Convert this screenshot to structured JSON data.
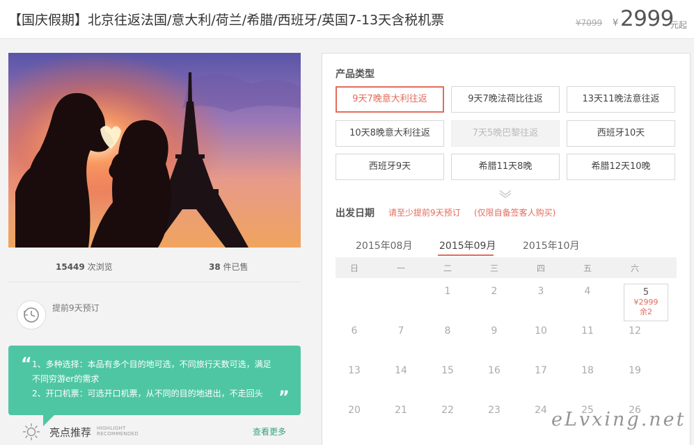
{
  "header": {
    "title": "【国庆假期】北京往返法国/意大利/荷兰/希腊/西班牙/英国7-13天含税机票",
    "original_price": "¥7099",
    "currency": "¥",
    "price": "2999",
    "price_suffix": "元起"
  },
  "stats": {
    "views_count": "15449",
    "views_label": "次浏览",
    "sold_count": "38",
    "sold_label": "件已售"
  },
  "advance": {
    "icon": "clock-icon",
    "text": "提前9天预订"
  },
  "highlights": {
    "open_quote": "“",
    "close_quote": "”",
    "line1": "1、多种选择：本品有多个目的地可选，不同旅行天数可选，满足不同穷游er的需求",
    "line2": "2、开口机票：可选开口机票，从不同的目的地进出，不走回头",
    "title": "亮点推荐",
    "title_en": [
      "HIGHLIGHT",
      "RECOMMENDED"
    ],
    "more_link": "查看更多"
  },
  "product": {
    "label": "产品类型",
    "options": [
      {
        "label": "9天7晚意大利往返",
        "state": "selected"
      },
      {
        "label": "9天7晚法荷比往返",
        "state": "normal"
      },
      {
        "label": "13天11晚法意往返",
        "state": "normal"
      },
      {
        "label": "10天8晚意大利往返",
        "state": "normal"
      },
      {
        "label": "7天5晚巴黎往返",
        "state": "disabled"
      },
      {
        "label": "西班牙10天",
        "state": "normal"
      },
      {
        "label": "西班牙9天",
        "state": "normal"
      },
      {
        "label": "希腊11天8晚",
        "state": "normal"
      },
      {
        "label": "希腊12天10晚",
        "state": "normal"
      }
    ]
  },
  "departure": {
    "label": "出发日期",
    "notice1": "请至少提前9天预订",
    "notice2": "(仅限自备签客人购买)",
    "months": [
      "2015年08月",
      "2015年09月",
      "2015年10月"
    ],
    "active_month": "2015年09月",
    "weekdays": [
      "日",
      "一",
      "二",
      "三",
      "四",
      "五",
      "六"
    ],
    "weeks": [
      [
        "",
        "",
        "1",
        "2",
        "3",
        "4",
        "5"
      ],
      [
        "6",
        "7",
        "8",
        "9",
        "10",
        "11",
        "12"
      ],
      [
        "13",
        "14",
        "15",
        "16",
        "17",
        "18",
        "19"
      ],
      [
        "20",
        "21",
        "22",
        "23",
        "24",
        "25",
        "26"
      ]
    ],
    "available": {
      "day": "5",
      "price": "¥2999",
      "remaining": "余2"
    }
  },
  "watermark": "eLvxing.net",
  "colors": {
    "accent": "#e36b5c",
    "teal": "#4fc6a3",
    "link_green": "#3aa37e"
  }
}
